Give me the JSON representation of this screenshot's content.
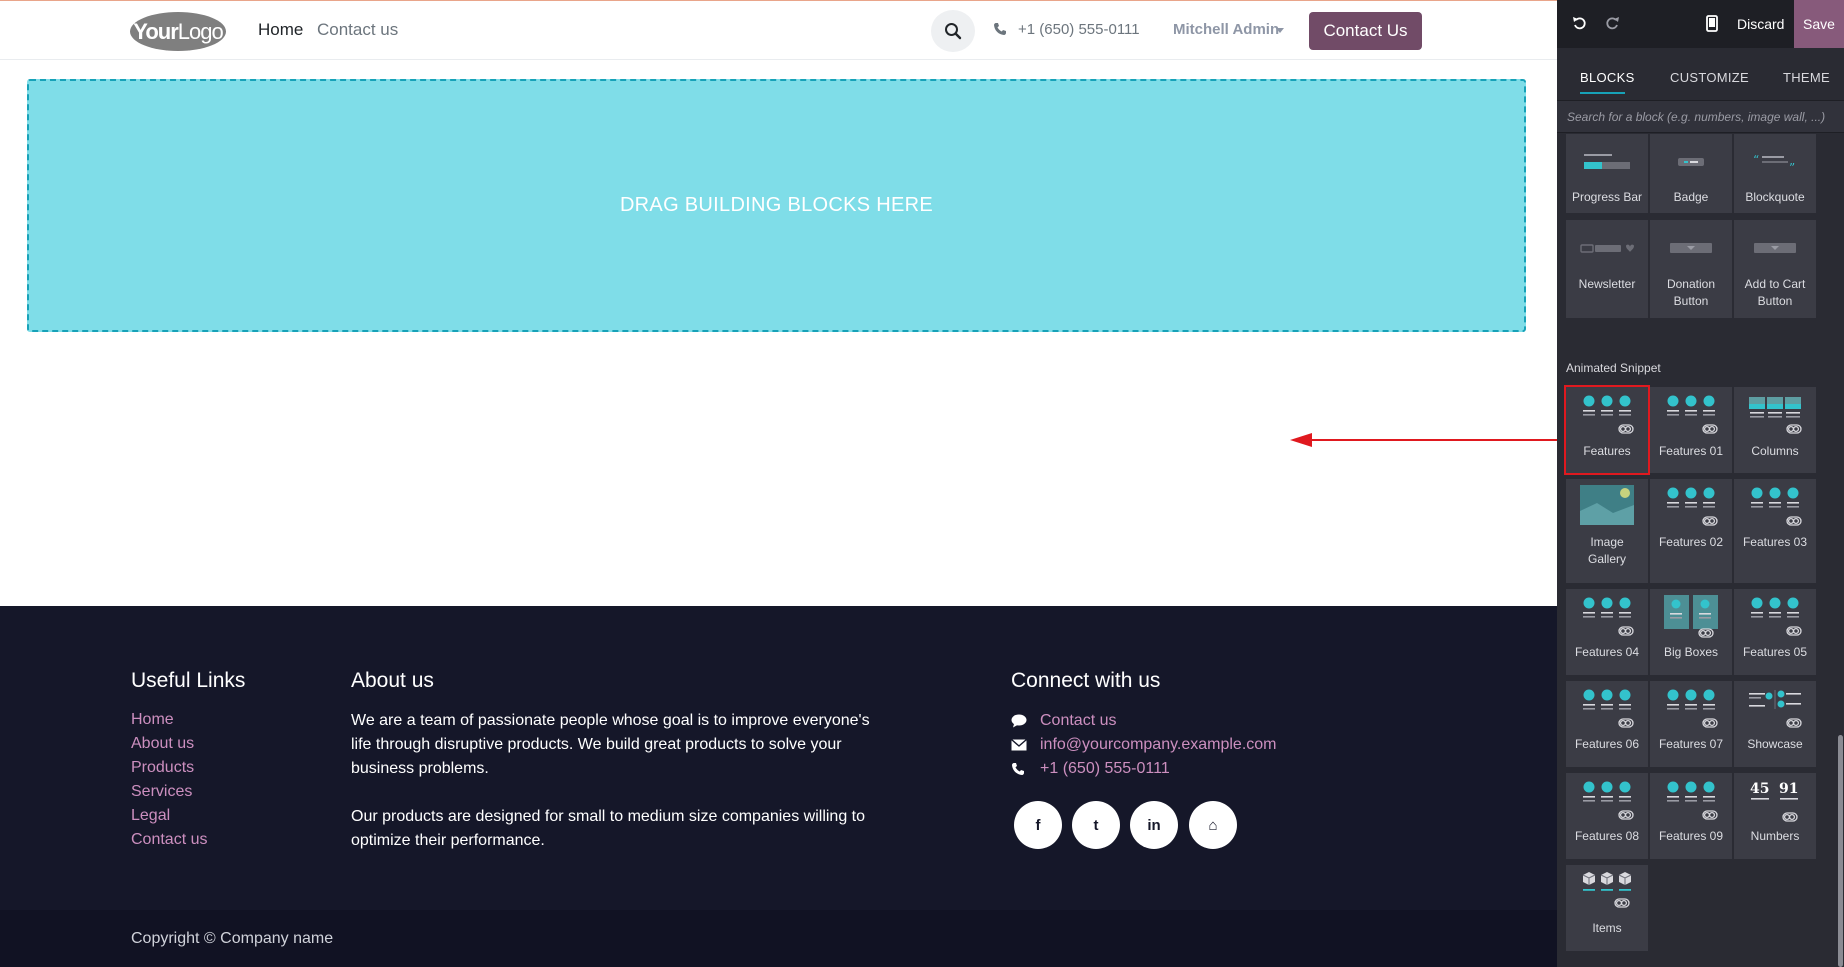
{
  "header": {
    "logo_bold": "Your",
    "logo_light": "Logo",
    "nav": [
      "Home",
      "Contact us"
    ],
    "phone": "+1 (650) 555-0111",
    "user": "Mitchell Admin",
    "cta": "Contact Us"
  },
  "dropzone": {
    "text": "DRAG BUILDING BLOCKS HERE"
  },
  "footer": {
    "links_title": "Useful Links",
    "links": [
      "Home",
      "About us",
      "Products",
      "Services",
      "Legal",
      "Contact us"
    ],
    "about_title": "About us",
    "about_p1": "We are a team of passionate people whose goal is to improve everyone's life through disruptive products. We build great products to solve your business problems.",
    "about_p2": "Our products are designed for small to medium size companies willing to optimize their performance.",
    "connect_title": "Connect with us",
    "contact_us": "Contact us",
    "email": "info@yourcompany.example.com",
    "phone": "+1 (650) 555-0111",
    "social": [
      {
        "icon": "facebook-icon",
        "glyph": "f"
      },
      {
        "icon": "twitter-icon",
        "glyph": "t"
      },
      {
        "icon": "linkedin-icon",
        "glyph": "in"
      },
      {
        "icon": "home-icon",
        "glyph": "⌂"
      }
    ],
    "copyright": "Copyright © Company name"
  },
  "editor": {
    "discard": "Discard",
    "save": "Save",
    "tabs": [
      "BLOCKS",
      "CUSTOMIZE",
      "THEME"
    ],
    "search_placeholder": "Search for a block (e.g. numbers, image wall, ...)",
    "inner_blocks": [
      "Progress Bar",
      "Badge",
      "Blockquote",
      "Newsletter",
      "Donation Button",
      "Add to Cart Button"
    ],
    "section_title": "Animated Snippet",
    "animated_blocks": [
      "Features",
      "Features 01",
      "Columns",
      "Image Gallery",
      "Features 02",
      "Features 03",
      "Features 04",
      "Big Boxes",
      "Features 05",
      "Features 06",
      "Features 07",
      "Showcase",
      "Features 08",
      "Features 09",
      "Numbers",
      "Items"
    ],
    "selected_block": "Features",
    "numbers_preview": [
      "45",
      "91"
    ]
  },
  "colors": {
    "brand": "#714b67",
    "accent": "#17a2b8",
    "dropzone_bg": "#7fdde8",
    "footer_bg": "#151729",
    "footer_link": "#cc8fbf",
    "highlight": "#e0191f"
  }
}
